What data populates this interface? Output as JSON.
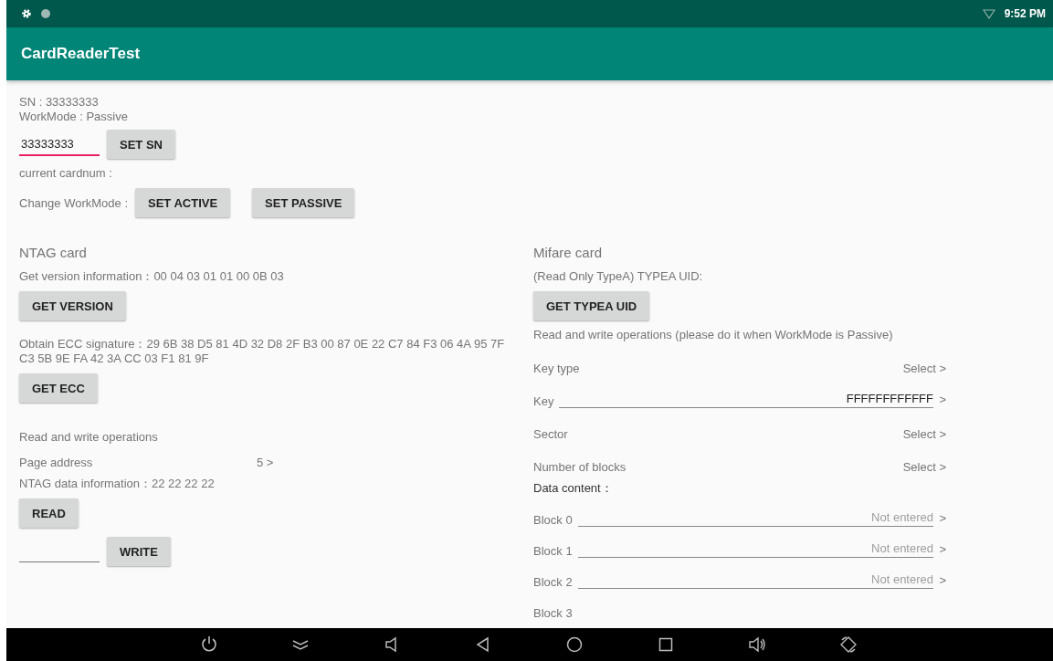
{
  "status_bar": {
    "time": "9:52 PM"
  },
  "app_bar": {
    "title": "CardReaderTest"
  },
  "device": {
    "sn_text": "SN : 33333333",
    "workmode_text": "WorkMode : Passive",
    "sn_field": {
      "value": "33333333",
      "focused": true
    },
    "set_sn_button": "SET SN",
    "cardnum_text": "current cardnum :",
    "workmode_label": "Change WorkMode :",
    "workmode_buttons": [
      "SET ACTIVE",
      "SET PASSIVE"
    ]
  },
  "ntag": {
    "title": "NTAG card",
    "version_text": "Get version information：00 04 03 01 01 00 0B 03",
    "get_version_button": "GET VERSION",
    "ecc_text": "Obtain ECC signature：29 6B 38 D5 81 4D 32 D8 2F B3 00 87 0E 22 C7 84 F3 06 4A 95 7F C3 5B 9E FA 42 3A CC 03 F1 81 9F",
    "get_ecc_button": "GET ECC",
    "rw_title": "Read and write operations",
    "page_address": {
      "label": "Page address",
      "value": "5 >"
    },
    "data_text": "NTAG data information：22 22 22 22",
    "read_button": "READ",
    "write_field": {
      "focused": false
    },
    "write_button": "WRITE"
  },
  "mifare": {
    "title": "Mifare card",
    "uid_text": "(Read Only TypeA) TYPEA UID:",
    "get_uid_button": "GET TYPEA UID",
    "rw_title": "Read and write operations (please do it when WorkMode is Passive)",
    "rows": [
      {
        "kind": "select",
        "label": "Key type",
        "value": "Select >"
      },
      {
        "kind": "input",
        "label": "Key",
        "value": "FFFFFFFFFFFF",
        "arrow": ">"
      },
      {
        "kind": "select",
        "label": "Sector",
        "value": "Select >"
      },
      {
        "kind": "select",
        "label": "Number of blocks",
        "value": "Select >"
      }
    ],
    "data_content_label": "Data content：",
    "blocks": [
      {
        "label": "Block 0",
        "placeholder": "Not entered",
        "arrow": ">"
      },
      {
        "label": "Block 1",
        "placeholder": "Not entered",
        "arrow": ">"
      },
      {
        "label": "Block 2",
        "placeholder": "Not entered",
        "arrow": ">"
      },
      {
        "label": "Block 3"
      }
    ]
  }
}
